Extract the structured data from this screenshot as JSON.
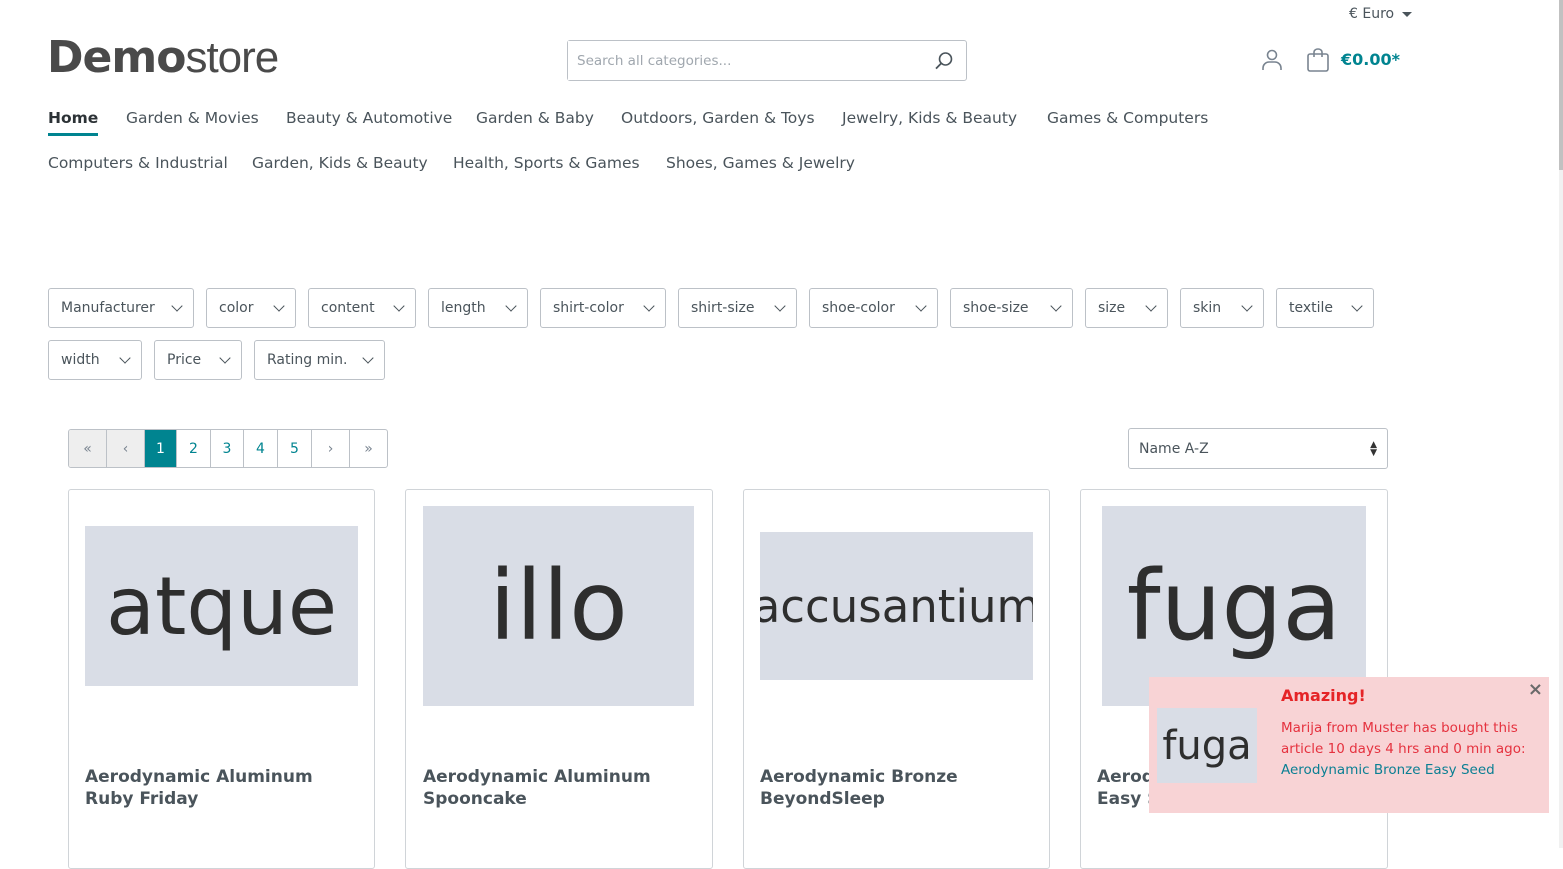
{
  "header": {
    "currency": "€ Euro",
    "logo_bold": "Demo",
    "logo_light": "store",
    "search_placeholder": "Search all categories...",
    "cart_total": "€0.00*"
  },
  "nav": [
    "Home",
    "Garden & Movies",
    "Beauty & Automotive",
    "Garden & Baby",
    "Outdoors, Garden & Toys",
    "Jewelry, Kids & Beauty",
    "Games & Computers",
    "Computers & Industrial",
    "Garden, Kids & Beauty",
    "Health, Sports & Games",
    "Shoes, Games & Jewelry"
  ],
  "filters": [
    "Manufacturer",
    "color",
    "content",
    "length",
    "shirt-color",
    "shirt-size",
    "shoe-color",
    "shoe-size",
    "size",
    "skin",
    "textile",
    "width",
    "Price",
    "Rating min."
  ],
  "pagination": {
    "first": "«",
    "prev": "‹",
    "pages": [
      "1",
      "2",
      "3",
      "4",
      "5"
    ],
    "current": "1",
    "next": "›",
    "last": "»"
  },
  "sort": {
    "selected": "Name A-Z"
  },
  "products": [
    {
      "image_text": "atque",
      "name": "Aerodynamic Aluminum Ruby Friday"
    },
    {
      "image_text": "illo",
      "name": "Aerodynamic Aluminum Spooncake"
    },
    {
      "image_text": "accusantium",
      "name": "Aerodynamic Bronze BeyondSleep"
    },
    {
      "image_text": "fuga",
      "name": "Aerodynamic Bronze Easy Seed"
    }
  ],
  "toast": {
    "title": "Amazing!",
    "image_text": "fuga",
    "message": "Marija from Muster has bought this article 10 days 4 hrs and 0 min ago:",
    "link": "Aerodynamic Bronze Easy Seed",
    "close": "×"
  },
  "colors": {
    "primary": "#008490",
    "toast_bg": "#f8d3d5",
    "toast_text": "#e52427"
  }
}
